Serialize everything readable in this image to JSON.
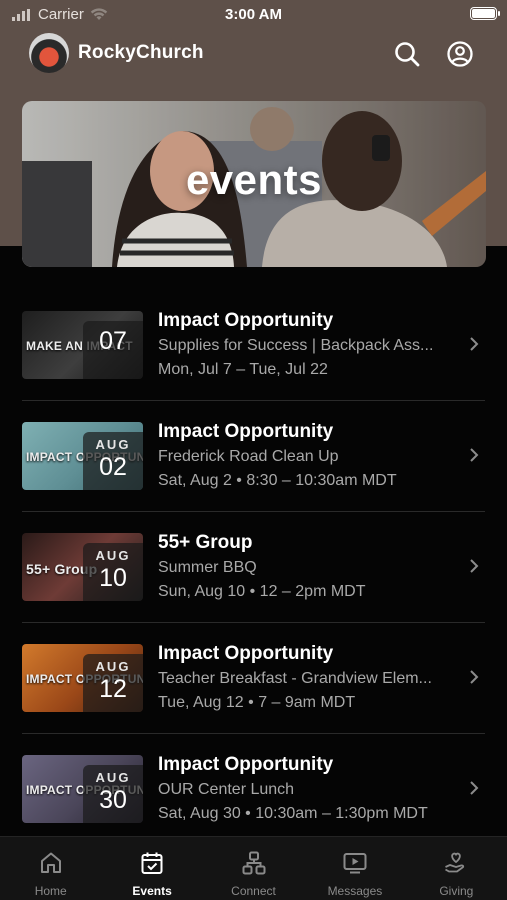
{
  "status_bar": {
    "carrier": "Carrier",
    "time": "3:00 AM"
  },
  "app": {
    "name": "RockyChurch"
  },
  "banner": {
    "title": "events"
  },
  "events": [
    {
      "thumb_label": "Make an Impact",
      "month": "",
      "day": "07",
      "title": "Impact Opportunity",
      "subtitle": "Supplies for Success | Backpack Ass...",
      "when": "Mon, Jul 7 – Tue, Jul 22",
      "accent": "#3a3a3a"
    },
    {
      "thumb_label": "Impact Opportunity",
      "month": "AUG",
      "day": "02",
      "title": "Impact Opportunity",
      "subtitle": "Frederick Road Clean Up",
      "when": "Sat, Aug 2 • 8:30 – 10:30am MDT",
      "accent": "#5f8f95"
    },
    {
      "thumb_label": "55+ Group",
      "month": "AUG",
      "day": "10",
      "title": "55+ Group",
      "subtitle": "Summer BBQ",
      "when": "Sun, Aug 10 • 12 – 2pm MDT",
      "accent": "#6e3b36"
    },
    {
      "thumb_label": "Impact Opportunity",
      "month": "AUG",
      "day": "12",
      "title": "Impact Opportunity",
      "subtitle": "Teacher Breakfast - Grandview Elem...",
      "when": "Tue, Aug 12 • 7 – 9am MDT",
      "accent": "#b45a1e"
    },
    {
      "thumb_label": "Impact Opportunity",
      "month": "AUG",
      "day": "30",
      "title": "Impact Opportunity",
      "subtitle": "OUR Center Lunch",
      "when": "Sat, Aug 30 • 10:30am – 1:30pm MDT",
      "accent": "#4b465a"
    }
  ],
  "tabs": [
    {
      "label": "Home",
      "icon": "home-icon",
      "active": false
    },
    {
      "label": "Events",
      "icon": "calendar-icon",
      "active": true
    },
    {
      "label": "Connect",
      "icon": "connect-icon",
      "active": false
    },
    {
      "label": "Messages",
      "icon": "messages-icon",
      "active": false
    },
    {
      "label": "Giving",
      "icon": "giving-icon",
      "active": false
    }
  ],
  "colors": {
    "background": "#050505",
    "hero": "#5e5049",
    "accent_text": "#ffffff",
    "muted_text": "#a9a9a9"
  }
}
